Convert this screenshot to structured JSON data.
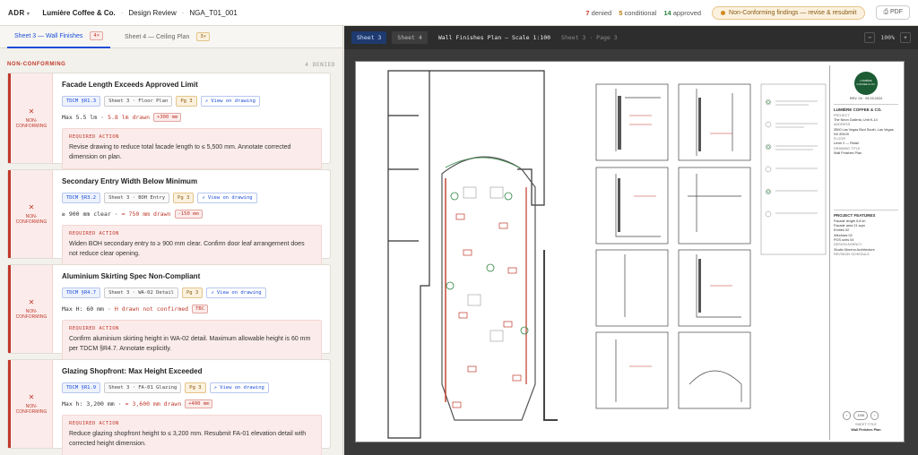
{
  "topbar": {
    "logo": "ADR",
    "project": "Lumière Coffee & Co.",
    "section": "Design Review",
    "doc_id": "NGA_T01_001",
    "denied_count": "7",
    "denied_label": "denied",
    "conditional_count": "5",
    "conditional_label": "conditional",
    "approved_count": "14",
    "approved_label": "approved",
    "alert": "Non-Conforming findings — revise & resubmit",
    "pdf_label": "PDF"
  },
  "tabs": [
    {
      "label": "Sheet 3 — Wall Finishes",
      "count": "4×"
    },
    {
      "label": "Sheet 4 — Ceiling Plan",
      "count": "3×"
    }
  ],
  "section": {
    "label": "NON-CONFORMING",
    "count": "4 DENIED"
  },
  "status_text": "NON-CONFORMING",
  "action_label": "REQUIRED ACTION",
  "findings": [
    {
      "title": "Facade Length Exceeds Approved Limit",
      "code": "TDCM §R1.3",
      "sheet": "Sheet 3 · Floor Plan",
      "page": "Pg 3",
      "link": "↗ View on drawing",
      "limit": "Max 5.5 lm",
      "drawn": "5.8 lm drawn",
      "delta": "+300 mm",
      "action": "Revise drawing to reduce total facade length to ≤ 5,500 mm. Annotate corrected dimension on plan."
    },
    {
      "title": "Secondary Entry Width Below Minimum",
      "code": "TDCM §R3.2",
      "sheet": "Sheet 3 · BOH Entry",
      "page": "Pg 3",
      "link": "↗ View on drawing",
      "limit": "≥ 900 mm clear",
      "drawn": "≈ 750 mm drawn",
      "delta": "-150 mm",
      "action": "Widen BOH secondary entry to ≥ 900 mm clear. Confirm door leaf arrangement does not reduce clear opening."
    },
    {
      "title": "Aluminium Skirting Spec Non-Compliant",
      "code": "TDCM §R4.7",
      "sheet": "Sheet 3 · WA-02 Detail",
      "page": "Pg 3",
      "link": "↗ View on drawing",
      "limit": "Max H: 60 mm",
      "drawn": "H drawn not confirmed",
      "delta": "TBC",
      "action": "Confirm aluminium skirting height in WA-02 detail. Maximum allowable height is 60 mm per TDCM §R4.7. Annotate explicitly."
    },
    {
      "title": "Glazing Shopfront: Max Height Exceeded",
      "code": "TDCM §R1.9",
      "sheet": "Sheet 3 · FA-01 Glazing",
      "page": "Pg 3",
      "link": "↗ View on drawing",
      "limit": "Max h: 3,200 mm",
      "drawn": "≈ 3,600 mm drawn",
      "delta": "+400 mm",
      "action": "Reduce glazing shopfront height to ≤ 3,200 mm. Resubmit FA-01 elevation detail with corrected height dimension."
    }
  ],
  "viewer": {
    "tab_active": "Sheet 3",
    "tab_other": "Sheet 4",
    "title": "Wall Finishes Plan — Scale 1:100",
    "subtitle": "Sheet 3 · Page 3",
    "zoom": "100%",
    "zoom_in": "+",
    "zoom_out": "−"
  },
  "title_block": {
    "brand": "LUMIÈRE COFFEE & CO.",
    "rev": "REV. 04 · 03.03.2024",
    "company": "LUMIÈRE COFFEE & CO.",
    "project_k": "PROJECT",
    "project_v": "The Neon Galleria, Unit K-14",
    "address_k": "ADDRESS",
    "address_v": "3500 Las Vegas Blvd South, Las Vegas, NV 89109",
    "floor_k": "FLOOR",
    "floor_v": "Level 2 — Retail",
    "drawing_k": "DRAWING TITLE",
    "drawing_v": "Wall Finishes Plan",
    "features_hd": "PROJECT FEATURES",
    "f1": "Facade length  5.8 lm",
    "f2": "Facade area  21 sqm",
    "f3": "Entries  02",
    "f4": "Windows  02",
    "f5": "POS units  04",
    "agency_k": "DESIGN AGENCY",
    "agency_v": "Studio Moreno Architecture",
    "revision": "REVISION SCHEDULE",
    "sheet_title": "SHEET TITLE",
    "sheet_name": "Wall Finishes Plan",
    "pager": "1/00"
  }
}
